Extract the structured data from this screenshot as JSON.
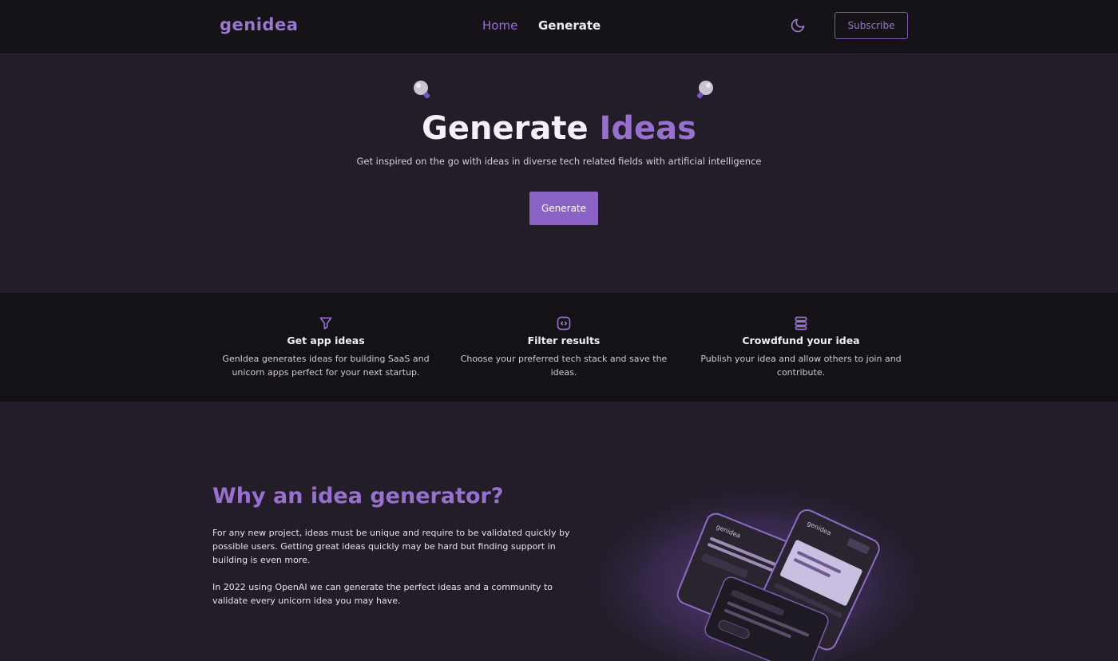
{
  "navbar": {
    "logo": "genidea",
    "links": [
      {
        "label": "Home",
        "active": true
      },
      {
        "label": "Generate",
        "active": false
      }
    ],
    "theme_icon": "moon-icon",
    "subscribe_label": "Subscribe"
  },
  "hero": {
    "title_part1": "Generate",
    "title_part2": "Ideas",
    "subtitle": "Get inspired on the go with ideas in diverse tech related fields with artificial intelligence",
    "button_label": "Generate",
    "decor_icons": [
      "lightbulb-icon",
      "lightbulb-icon"
    ]
  },
  "features": [
    {
      "icon": "filter-icon",
      "title": "Get app ideas",
      "description": "GenIdea generates ideas for building SaaS and unicorn apps perfect for your next startup."
    },
    {
      "icon": "code-icon",
      "title": "Filter results",
      "description": "Choose your preferred tech stack and save the ideas."
    },
    {
      "icon": "stack-icon",
      "title": "Crowdfund your idea",
      "description": "Publish your idea and allow others to join and contribute."
    }
  ],
  "why": {
    "title": "Why an idea generator?",
    "paragraph1": "For any new project, ideas must be unique and require to be validated quickly by possible users. Getting great ideas quickly may be hard but finding support in building is even more.",
    "paragraph2": "In 2022 using OpenAI we can generate the perfect ideas and a community to validate every unicorn idea you may have."
  },
  "phones_illustration": {
    "logo_text": "genidea"
  },
  "colors": {
    "accent": "#8b63c4",
    "background": "#221d29",
    "navbar": "#151318",
    "features_band": "#141216"
  }
}
